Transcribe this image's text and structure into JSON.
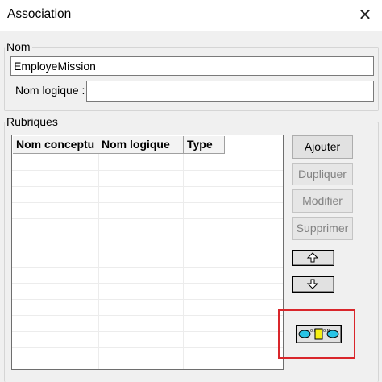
{
  "window": {
    "title": "Association",
    "close_glyph": "✕"
  },
  "nom_group": {
    "legend": "Nom",
    "name_value": "EmployeMission",
    "logical_label": "Nom logique :",
    "logical_value": ""
  },
  "rubriques_group": {
    "legend": "Rubriques",
    "columns": [
      "Nom conceptu",
      "Nom logique",
      "Type"
    ],
    "rows": []
  },
  "buttons": {
    "ajouter": "Ajouter",
    "dupliquer": "Dupliquer",
    "modifier": "Modifier",
    "supprimer": "Supprimer",
    "move_up_icon": "arrow-up-icon",
    "move_down_icon": "arrow-down-icon",
    "association_icon": "association-icon"
  },
  "colors": {
    "highlight": "#d9262b",
    "entity_left": "#29c4e6",
    "entity_right": "#29c4e6",
    "association_box": "#f5ef14"
  }
}
